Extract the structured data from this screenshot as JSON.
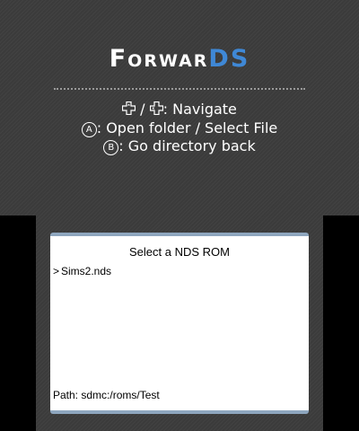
{
  "top_screen": {
    "logo": {
      "part1": "Forwar",
      "part2": "DS",
      "accent_color": "#3f88d6"
    },
    "help": [
      {
        "icons": [
          "dpad-icon",
          "dpad-icon"
        ],
        "separator": " / ",
        "text": ": Navigate"
      },
      {
        "icon": "a-button-icon",
        "icon_glyph": "A",
        "text": ": Open folder / Select File"
      },
      {
        "icon": "b-button-icon",
        "icon_glyph": "B",
        "text": ": Go directory back"
      }
    ]
  },
  "bottom_screen": {
    "title": "Select a NDS ROM",
    "cursor": ">",
    "files": [
      {
        "name": "Sims2.nds",
        "selected": true
      }
    ],
    "path_label": "Path: sdmc:/roms/Test"
  }
}
